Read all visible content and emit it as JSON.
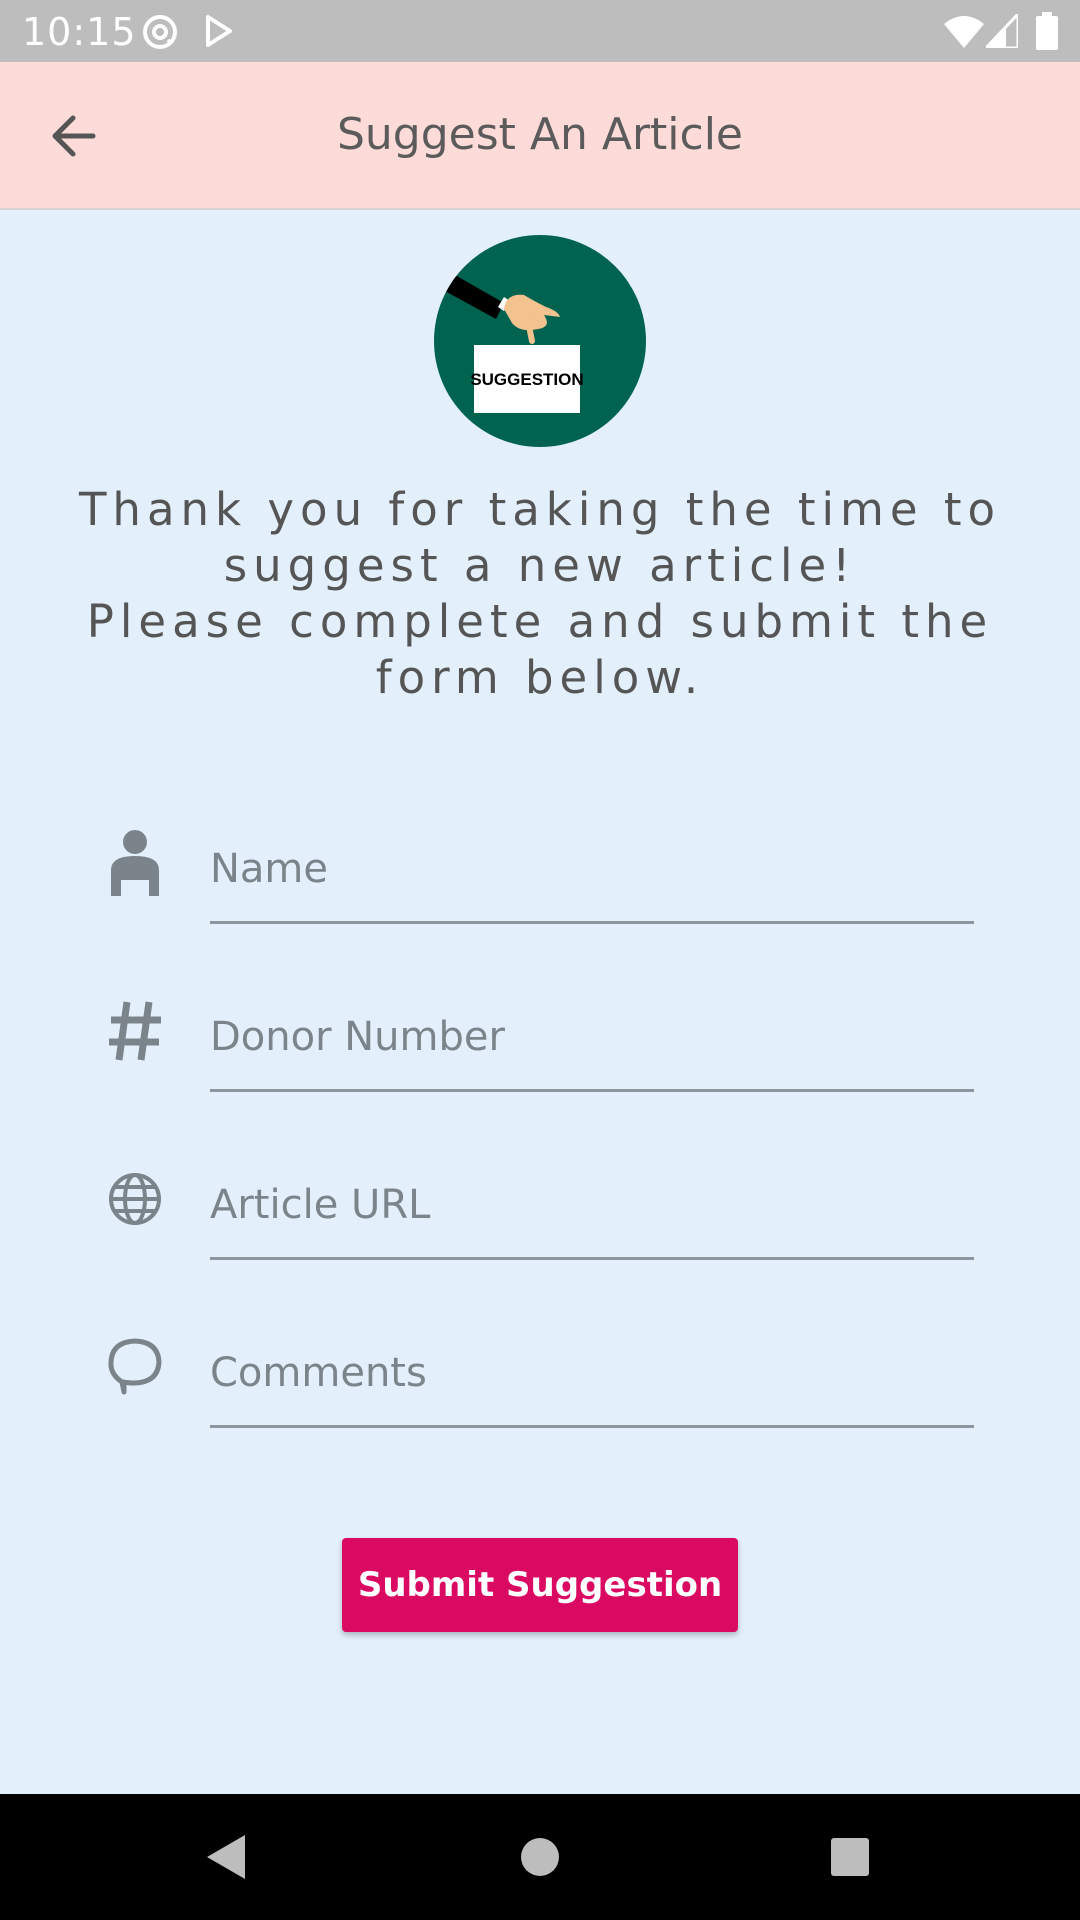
{
  "status_bar": {
    "time": "10:15",
    "icons": [
      "at-sign-icon",
      "play-store-icon",
      "wifi-icon",
      "signal-icon",
      "battery-icon"
    ]
  },
  "app_bar": {
    "title": "Suggest An Article",
    "back_icon": "arrow-left-icon"
  },
  "logo": {
    "text": "SUGGESTION",
    "background_color": "#006350"
  },
  "intro": {
    "line1": "Thank you for taking the time to suggest a new article!",
    "line2": "Please complete and submit the form below."
  },
  "form": {
    "fields": [
      {
        "icon": "person-icon",
        "placeholder": "Name",
        "value": ""
      },
      {
        "icon": "hash-icon",
        "placeholder": "Donor Number",
        "value": ""
      },
      {
        "icon": "globe-icon",
        "placeholder": "Article URL",
        "value": ""
      },
      {
        "icon": "chat-bubble-icon",
        "placeholder": "Comments",
        "value": ""
      }
    ],
    "submit_label": "Submit Suggestion"
  },
  "colors": {
    "app_bar": "#fddbd8",
    "background": "#e3f0fc",
    "accent": "#da0a63"
  }
}
